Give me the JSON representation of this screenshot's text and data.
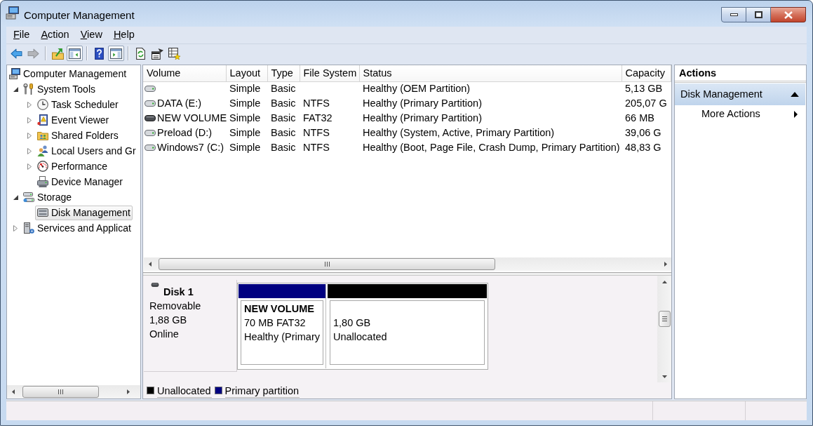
{
  "window": {
    "title": "Computer Management"
  },
  "menu": [
    "File",
    "Action",
    "View",
    "Help"
  ],
  "toolbar": [
    [
      {
        "disabled": false,
        "pressed": false
      },
      {
        "disabled": true,
        "pressed": false
      }
    ],
    [
      {
        "disabled": false,
        "pressed": false
      },
      {
        "disabled": false,
        "pressed": true
      }
    ],
    [
      {
        "disabled": false,
        "pressed": false
      },
      {
        "disabled": false,
        "pressed": true
      }
    ],
    [
      {
        "disabled": false,
        "pressed": false
      },
      {
        "disabled": false,
        "pressed": false
      },
      {
        "disabled": false,
        "pressed": false
      }
    ]
  ],
  "tree": [
    {
      "label": "Computer Management",
      "selected": false,
      "children": [
        {
          "label": "System Tools",
          "selected": false,
          "expanded": true,
          "children": [
            {
              "label": "Task Scheduler",
              "selected": false,
              "expanded": false
            },
            {
              "label": "Event Viewer",
              "selected": false,
              "expanded": false
            },
            {
              "label": "Shared Folders",
              "selected": false,
              "expanded": false
            },
            {
              "label": "Local Users and Gr",
              "selected": false,
              "expanded": false
            },
            {
              "label": "Performance",
              "selected": false,
              "expanded": false
            },
            {
              "label": "Device Manager",
              "selected": false
            }
          ]
        },
        {
          "label": "Storage",
          "selected": false,
          "expanded": true,
          "children": [
            {
              "label": "Disk Management",
              "selected": true
            }
          ]
        },
        {
          "label": "Services and Applicat",
          "selected": false,
          "expanded": false
        }
      ]
    }
  ],
  "table": {
    "columns": [
      "Volume",
      "Layout",
      "Type",
      "File System",
      "Status",
      "Capacity"
    ],
    "rows": [
      {
        "kind": "fixed",
        "layout": "Simple",
        "type": "Basic",
        "status": "Healthy (OEM Partition)",
        "capacity": "5,13 GB"
      },
      {
        "kind": "fixed",
        "volume": "DATA (E:)",
        "layout": "Simple",
        "type": "Basic",
        "file_system": "NTFS",
        "status": "Healthy (Primary Partition)",
        "capacity": "205,07 G"
      },
      {
        "kind": "removable",
        "volume": "NEW VOLUME",
        "layout": "Simple",
        "type": "Basic",
        "file_system": "FAT32",
        "status": "Healthy (Primary Partition)",
        "capacity": "66 MB"
      },
      {
        "kind": "fixed",
        "volume": "Preload (D:)",
        "layout": "Simple",
        "type": "Basic",
        "file_system": "NTFS",
        "status": "Healthy (System, Active, Primary Partition)",
        "capacity": "39,06 G"
      },
      {
        "kind": "fixed",
        "volume": "Windows7 (C:)",
        "layout": "Simple",
        "type": "Basic",
        "file_system": "NTFS",
        "status": "Healthy (Boot, Page File, Crash Dump, Primary Partition)",
        "capacity": "48,83 G"
      }
    ]
  },
  "disks": [
    {
      "name": "Disk 1",
      "kind": "removable",
      "lines": [
        "Removable",
        "1,88 GB",
        "Online"
      ],
      "partitions": [
        {
          "name": "NEW VOLUME",
          "color": "#000080",
          "lines": [
            "70 MB FAT32",
            "Healthy (Primary"
          ]
        },
        {
          "color": "#000000",
          "lines": [
            "1,80 GB",
            "Unallocated"
          ]
        }
      ]
    }
  ],
  "legend": [
    {
      "label": "Unallocated",
      "color": "#000000"
    },
    {
      "label": "Primary partition",
      "color": "#000080"
    }
  ],
  "actions": {
    "title": "Actions",
    "sections": [
      {
        "label": "Disk Management",
        "expanded": true,
        "items": [
          {
            "label": "More Actions",
            "submenu": true
          }
        ]
      }
    ]
  }
}
